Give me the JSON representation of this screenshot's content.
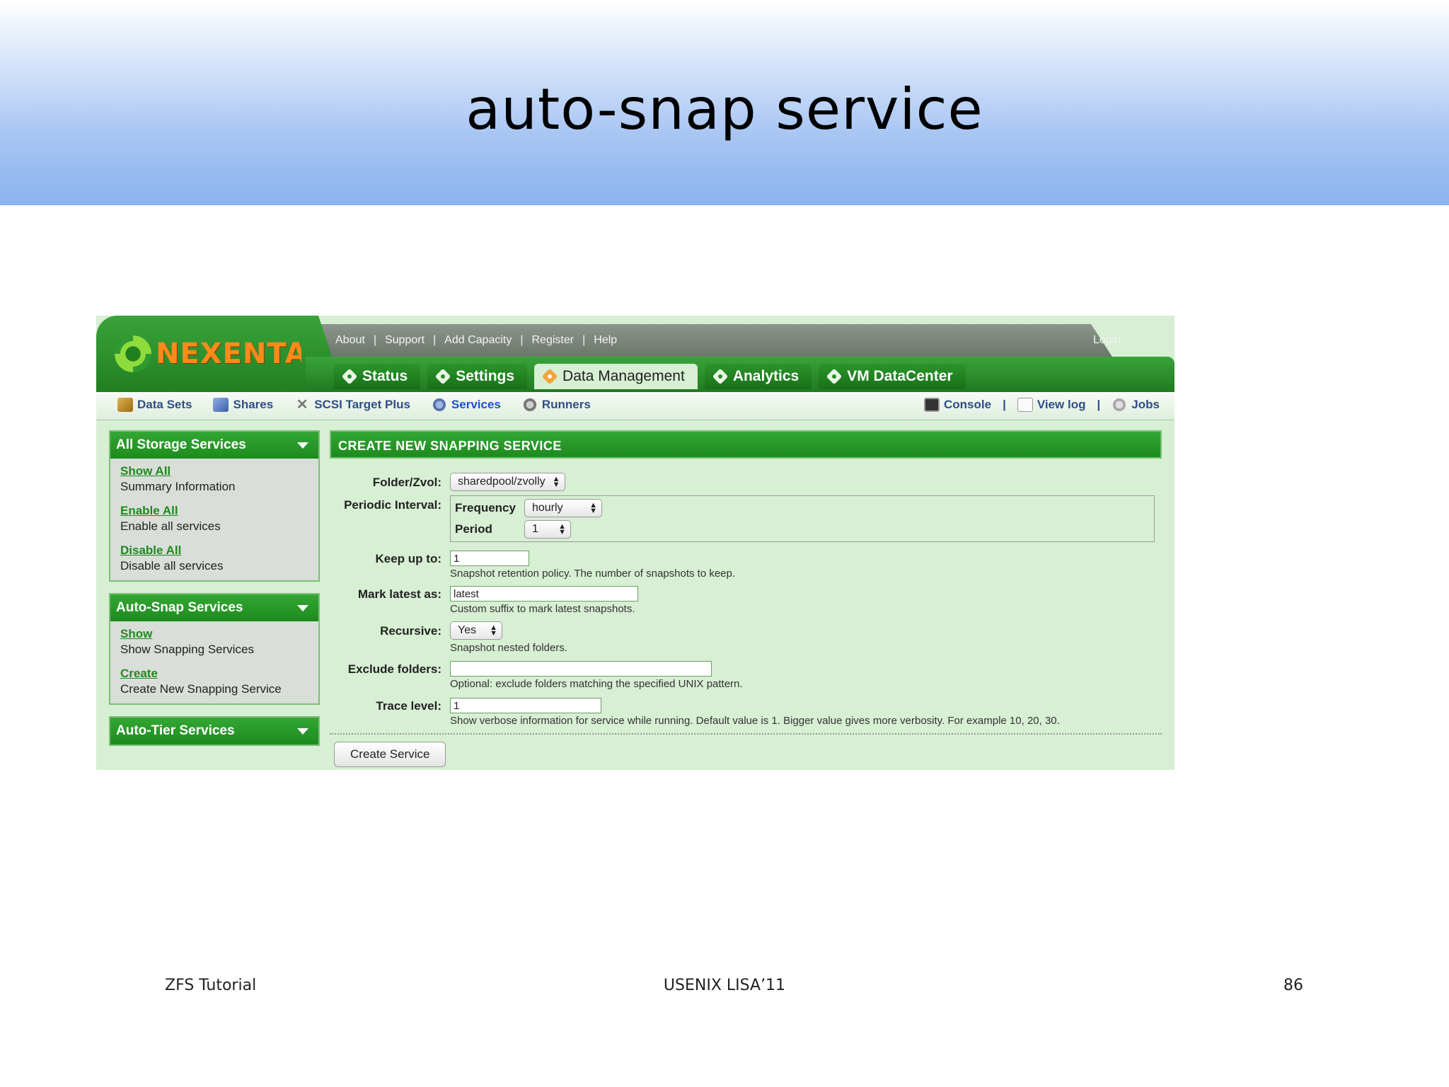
{
  "slide": {
    "title": "auto-snap service",
    "footer_left": "ZFS Tutorial",
    "footer_center": "USENIX LISA’11",
    "footer_right": "86"
  },
  "app": {
    "logo_text": "NEXENTA",
    "top_links": [
      "About",
      "Support",
      "Add Capacity",
      "Register",
      "Help"
    ],
    "login": "Login",
    "tabs": [
      {
        "label": "Status",
        "active": false
      },
      {
        "label": "Settings",
        "active": false
      },
      {
        "label": "Data Management",
        "active": true
      },
      {
        "label": "Analytics",
        "active": false
      },
      {
        "label": "VM DataCenter",
        "active": false
      }
    ],
    "subnav_left": [
      {
        "label": "Data Sets",
        "icon": "datasets-icon"
      },
      {
        "label": "Shares",
        "icon": "shares-icon"
      },
      {
        "label": "SCSI Target Plus",
        "icon": "scsi-tools-icon"
      },
      {
        "label": "Services",
        "icon": "services-gear-icon",
        "active": true
      },
      {
        "label": "Runners",
        "icon": "runners-gear-icon"
      }
    ],
    "subnav_right": [
      {
        "label": "Console",
        "icon": "console-icon"
      },
      {
        "label": "View log",
        "icon": "log-icon"
      },
      {
        "label": "Jobs",
        "icon": "jobs-gear-icon"
      }
    ],
    "sidebar": [
      {
        "title": "All Storage Services",
        "items": [
          {
            "link": "Show All",
            "desc": "Summary Information"
          },
          {
            "link": "Enable All",
            "desc": "Enable all services"
          },
          {
            "link": "Disable All",
            "desc": "Disable all services"
          }
        ]
      },
      {
        "title": "Auto-Snap Services",
        "items": [
          {
            "link": "Show",
            "desc": "Show Snapping Services"
          },
          {
            "link": "Create",
            "desc": "Create New Snapping Service"
          }
        ]
      },
      {
        "title": "Auto-Tier Services",
        "items": []
      }
    ],
    "form": {
      "heading": "CREATE NEW SNAPPING SERVICE",
      "folder_label": "Folder/Zvol:",
      "folder_value": "sharedpool/zvolly",
      "interval_label": "Periodic Interval:",
      "frequency_label": "Frequency",
      "frequency_value": "hourly",
      "period_label": "Period",
      "period_value": "1",
      "keep_label": "Keep up to:",
      "keep_value": "1",
      "keep_hint": "Snapshot retention policy. The number of snapshots to keep.",
      "mark_label": "Mark latest as:",
      "mark_value": "latest",
      "mark_hint": "Custom suffix to mark latest snapshots.",
      "recursive_label": "Recursive:",
      "recursive_value": "Yes",
      "recursive_hint": "Snapshot nested folders.",
      "exclude_label": "Exclude folders:",
      "exclude_value": "",
      "exclude_hint": "Optional: exclude folders matching the specified UNIX pattern.",
      "trace_label": "Trace level:",
      "trace_value": "1",
      "trace_hint": "Show verbose information for service while running. Default value is 1. Bigger value gives more verbosity. For example 10, 20, 30.",
      "submit_label": "Create Service"
    }
  }
}
